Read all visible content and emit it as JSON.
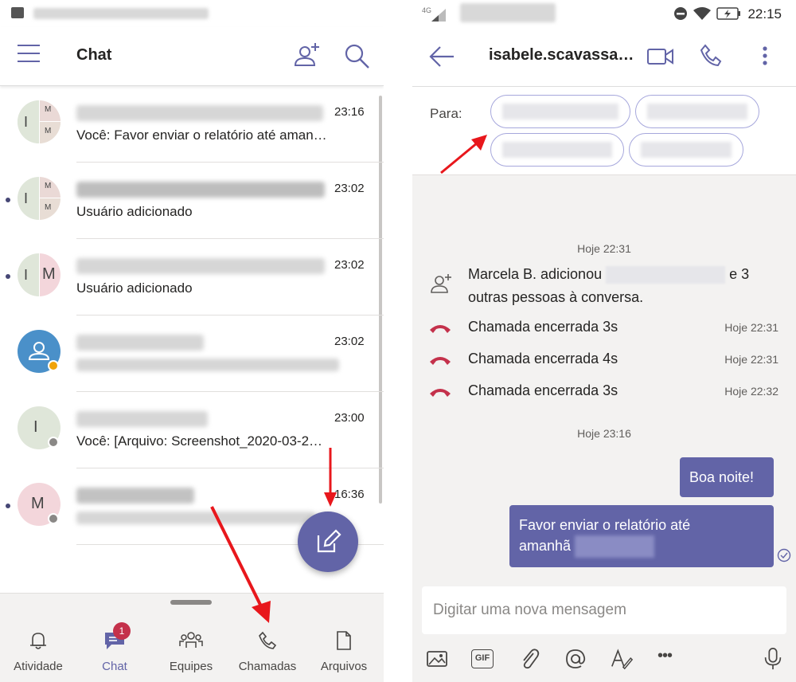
{
  "left": {
    "header": {
      "title": "Chat"
    },
    "chats": [
      {
        "initials": "I",
        "sub_initials": [
          "M",
          "M"
        ],
        "time": "23:16",
        "preview": "Você: Favor enviar o relatório até aman…",
        "unread": false,
        "group": true
      },
      {
        "initials": "I",
        "sub_initials": [
          "M",
          "M"
        ],
        "time": "23:02",
        "preview": "Usuário adicionado",
        "unread": true,
        "group": true
      },
      {
        "initials": "I",
        "sub_initials": [
          "M"
        ],
        "time": "23:02",
        "preview": "Usuário adicionado",
        "unread": true,
        "group": "split"
      },
      {
        "initials": "",
        "time": "23:02",
        "preview": "",
        "unread": false,
        "group": false
      },
      {
        "initials": "I",
        "time": "23:00",
        "preview": "Você: [Arquivo: Screenshot_2020-03-2…",
        "unread": false,
        "group": false
      },
      {
        "initials": "M",
        "time": "16:36",
        "preview": "",
        "unread": true,
        "group": false
      }
    ],
    "nav": [
      {
        "label": "Atividade",
        "icon": "bell-icon"
      },
      {
        "label": "Chat",
        "icon": "chat-icon",
        "badge": "1",
        "active": true
      },
      {
        "label": "Equipes",
        "icon": "teams-icon"
      },
      {
        "label": "Chamadas",
        "icon": "phone-icon"
      },
      {
        "label": "Arquivos",
        "icon": "file-icon"
      }
    ]
  },
  "right": {
    "status": {
      "network": "4G",
      "time": "22:15"
    },
    "header": {
      "title": "isabele.scavassa…"
    },
    "to_label": "Para:",
    "messages": {
      "ts1": "Hoje 22:31",
      "system_line1": "Marcela B. adicionou",
      "system_line1_tail": "e 3",
      "system_line2": "outras pessoas à conversa.",
      "calls": [
        {
          "text": "Chamada encerrada 3s",
          "time": "Hoje 22:31"
        },
        {
          "text": "Chamada encerrada 4s",
          "time": "Hoje 22:31"
        },
        {
          "text": "Chamada encerrada 3s",
          "time": "Hoje 22:32"
        }
      ],
      "ts2": "Hoje 23:16",
      "bubble1": "Boa noite!",
      "bubble2_line1": "Favor enviar o relatório até",
      "bubble2_line2": "amanhã"
    },
    "compose": {
      "placeholder": "Digitar uma nova mensagem"
    },
    "toolbar": {
      "gif_label": "GIF",
      "more_label": "•••"
    }
  },
  "colors": {
    "accent": "#6264a7",
    "call_end": "#c4314b",
    "arrow": "#e8171c"
  }
}
